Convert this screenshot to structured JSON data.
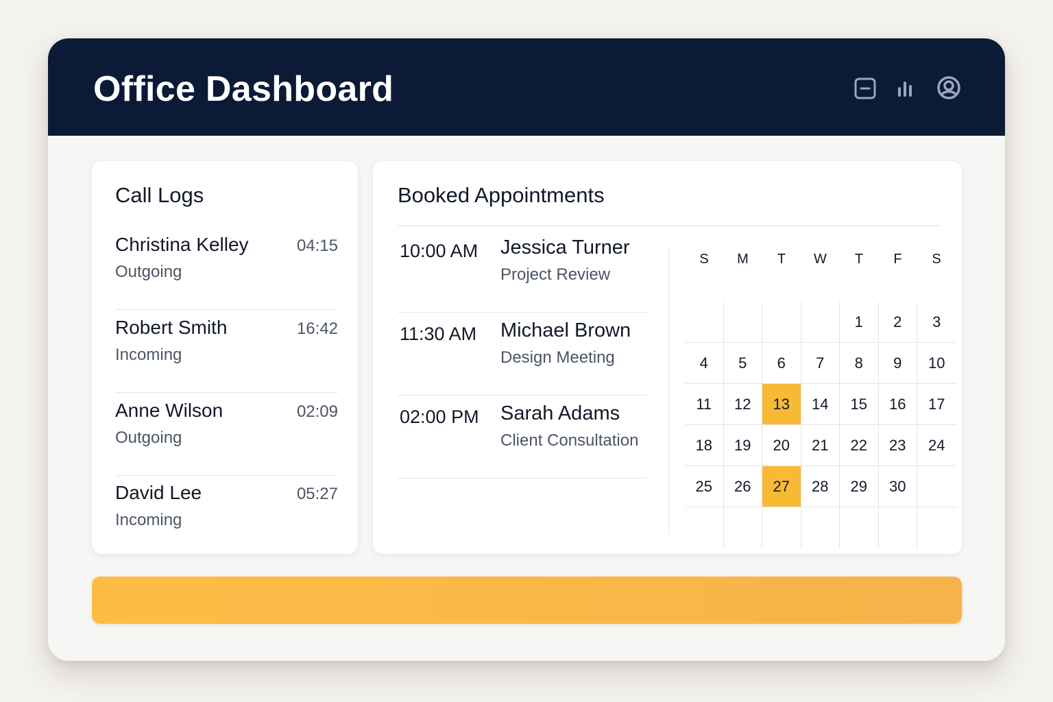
{
  "header": {
    "title": "Office Dashboard",
    "icons": [
      "archive-icon",
      "bar-chart-icon",
      "user-profile-icon"
    ]
  },
  "colors": {
    "header_bg": "#0b1a36",
    "accent": "#f8b935",
    "card_bg": "#ffffff"
  },
  "call_logs": {
    "title": "Call Logs",
    "items": [
      {
        "name": "Christina Kelley",
        "time": "04:15",
        "direction": "Outgoing"
      },
      {
        "name": "Robert Smith",
        "time": "16:42",
        "direction": "Incoming"
      },
      {
        "name": "Anne Wilson",
        "time": "02:09",
        "direction": "Outgoing"
      },
      {
        "name": "David Lee",
        "time": "05:27",
        "direction": "Incoming"
      }
    ]
  },
  "appointments": {
    "title": "Booked Appointments",
    "items": [
      {
        "time": "10:00 AM",
        "name": "Jessica Turner",
        "description": "Project Review"
      },
      {
        "time": "11:30 AM",
        "name": "Michael Brown",
        "description": "Design Meeting"
      },
      {
        "time": "02:00 PM",
        "name": "Sarah Adams",
        "description": "Client Consultation"
      }
    ]
  },
  "calendar": {
    "weekdays": [
      "S",
      "M",
      "T",
      "W",
      "T",
      "F",
      "S"
    ],
    "first_weekday_index": 4,
    "days_in_month": 30,
    "highlighted_days": [
      13,
      27
    ]
  }
}
